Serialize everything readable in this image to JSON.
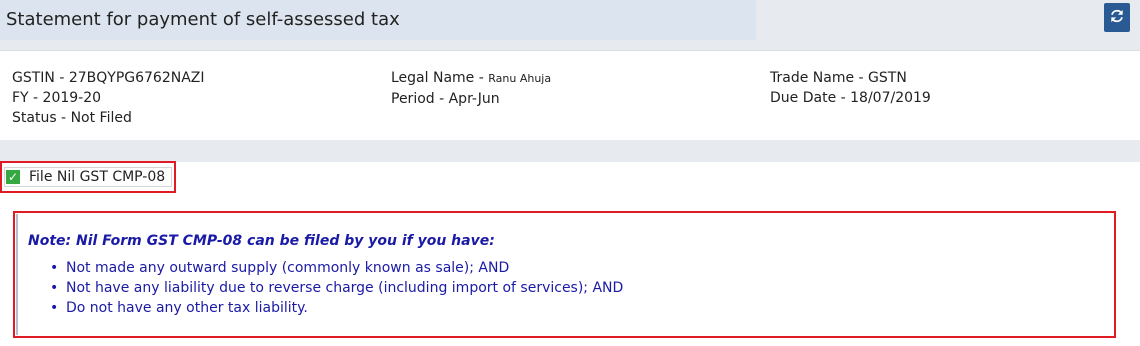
{
  "header": {
    "title": "Statement for payment of self-assessed tax",
    "refresh_icon": "refresh-icon"
  },
  "info": {
    "gstin": "GSTIN - 27BQYPG6762NAZI",
    "fy": "FY - 2019-20",
    "status": "Status - Not Filed",
    "legal_name_label": "Legal Name - ",
    "legal_name_value": "Ranu Ahuja",
    "period": "Period - Apr-Jun",
    "trade_name": "Trade Name - GSTN",
    "due_date": "Due Date - 18/07/2019"
  },
  "nil_filing": {
    "label": "File Nil GST CMP-08",
    "checked": true
  },
  "note": {
    "title": "Note: Nil Form GST CMP-08 can be filed by you if you have:",
    "items": [
      "Not made any outward supply (commonly known as sale); AND",
      "Not have any liability due to reverse charge (including import of services); AND",
      "Do not have any other tax liability."
    ]
  },
  "colors": {
    "accent": "#2a5a94",
    "highlight_border": "#e01b24",
    "note_text": "#1a1aa6",
    "check": "#35a841"
  }
}
